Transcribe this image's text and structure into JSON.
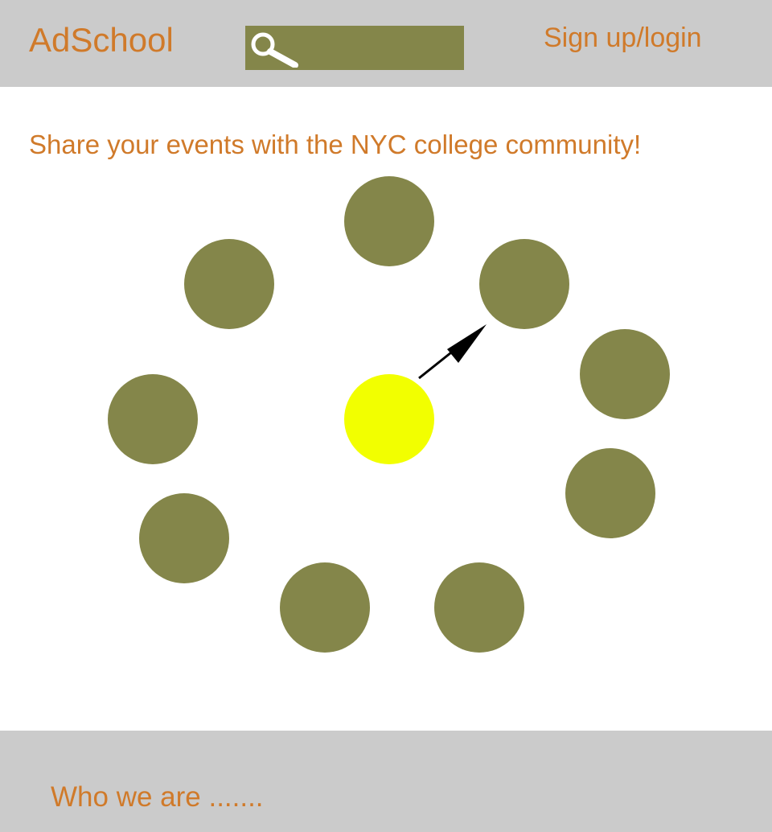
{
  "header": {
    "logo": "AdSchool",
    "search": {
      "value": "",
      "placeholder": "",
      "icon": "search-icon"
    },
    "signup_label": "Sign up/login"
  },
  "main": {
    "tagline": "Share your events with the NYC college community!",
    "event_cluster": {
      "event_count": 9,
      "event_color": "#84864a",
      "center_color": "#f2ff00",
      "arrow_icon": "arrow-icon"
    }
  },
  "footer": {
    "about_label": "Who we are ......."
  },
  "colors": {
    "accent": "#d07a2a",
    "bar": "#cbcbcb",
    "olive": "#84864a",
    "highlight": "#f2ff00"
  }
}
